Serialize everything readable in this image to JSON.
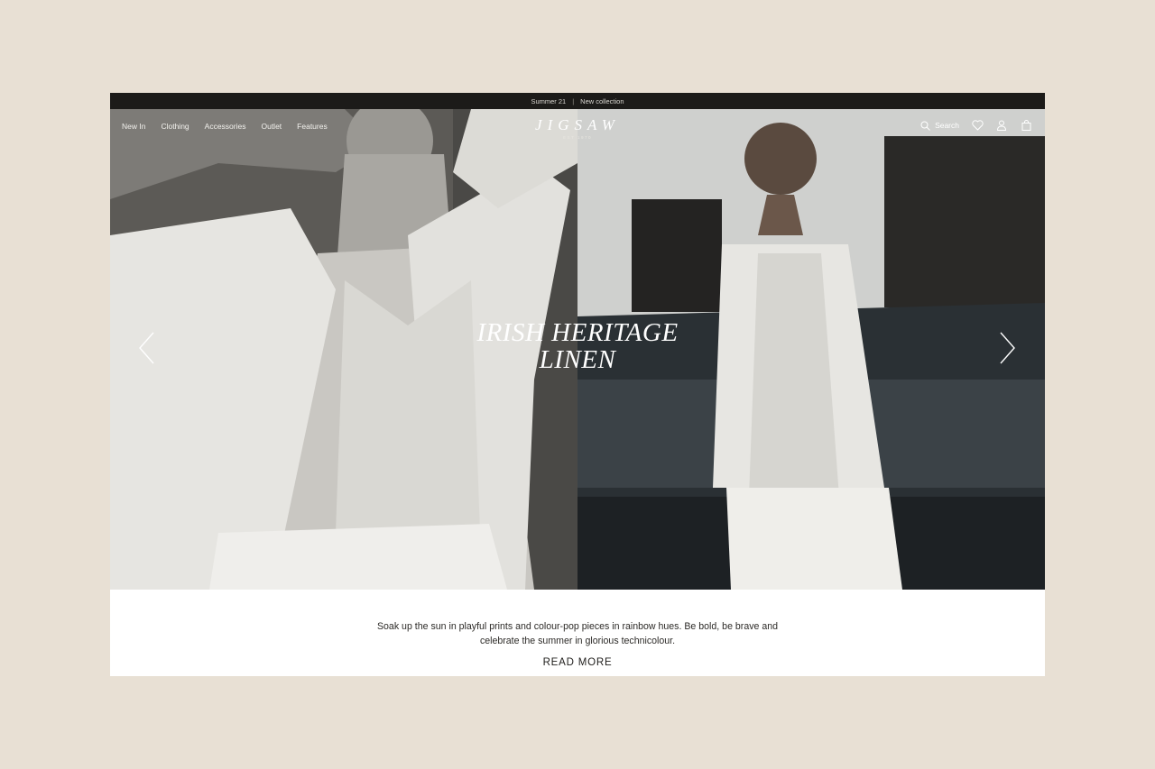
{
  "announcement": {
    "left": "Summer 21",
    "separator": "|",
    "right": "New collection"
  },
  "nav": {
    "items": [
      {
        "label": "New In"
      },
      {
        "label": "Clothing"
      },
      {
        "label": "Accessories"
      },
      {
        "label": "Outlet"
      },
      {
        "label": "Features"
      }
    ],
    "search_label": "Search",
    "icons": [
      "search-icon",
      "heart-icon",
      "user-icon",
      "bag-icon"
    ]
  },
  "logo": {
    "name": "JIGSAW",
    "established": "EST 1970"
  },
  "hero": {
    "headline_line1": "IRISH HERITAGE",
    "headline_line2": "LINEN",
    "icons": [
      "chevron-left-icon",
      "chevron-right-icon"
    ]
  },
  "promo": {
    "text_line1": "Soak up the sun in playful prints and colour-pop pieces in rainbow hues. Be bold, be brave and",
    "text_line2": "celebrate the summer in glorious technicolour.",
    "cta": "READ MORE"
  },
  "colors": {
    "page_background": "#e8e0d4",
    "announcement_bar": "#1c1b19",
    "text": "#2c2a27"
  }
}
